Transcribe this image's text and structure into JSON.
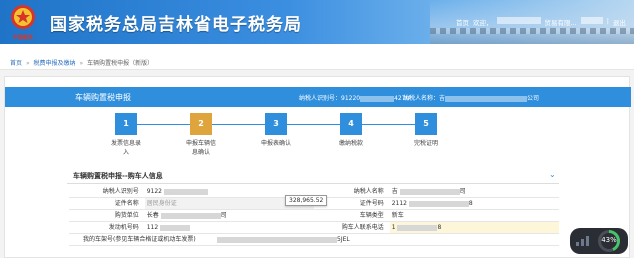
{
  "header": {
    "site_title": "国家税务总局吉林省电子税务局",
    "emblem_text": "中国税务",
    "links": {
      "home": "首页",
      "welcome": "欢迎，",
      "company": "贸易有限...",
      "sep": "|",
      "logout": "退出"
    }
  },
  "breadcrumb": {
    "items": [
      "首页",
      "税费申报及缴纳",
      "车辆购置税申报（新版）"
    ],
    "sep": "»"
  },
  "card": {
    "title": "车辆购置税申报",
    "taxpayer_id_label": "纳税人识别号：",
    "taxpayer_id_value_start": "91220",
    "taxpayer_id_value_end": "427U",
    "taxpayer_name_label": "纳税人名称：",
    "taxpayer_name_value_start": "吉",
    "taxpayer_name_value_end": "公司"
  },
  "steps": [
    {
      "num": "1",
      "label_line1": "发票信息录",
      "label_line2": "入",
      "active": false
    },
    {
      "num": "2",
      "label_line1": "申报车辆信",
      "label_line2": "息确认",
      "active": true
    },
    {
      "num": "3",
      "label_line1": "申报表确认",
      "label_line2": "",
      "active": false
    },
    {
      "num": "4",
      "label_line1": "缴纳税款",
      "label_line2": "",
      "active": false
    },
    {
      "num": "5",
      "label_line1": "完税证明",
      "label_line2": "",
      "active": false
    }
  ],
  "section": {
    "title": "车辆购置税申报--购车人信息",
    "chevron": "⌄"
  },
  "form": {
    "taxpayer_id_label": "纳税人识别号",
    "taxpayer_id_value": "9122",
    "taxpayer_name_label": "纳税人名称",
    "taxpayer_name_value_start": "吉",
    "taxpayer_name_value_end": "司",
    "id_type_label": "证件名称",
    "id_type_value": "居民身份证",
    "id_no_label": "证件号码",
    "id_no_value_start": "2112",
    "id_no_value_end": "8",
    "unit_label": "购货单位",
    "unit_value_start": "长春",
    "unit_value_end": "司",
    "vehicle_type_label": "车辆类型",
    "vehicle_type_value": "新车",
    "engine_label": "发动机号码",
    "engine_value": "112",
    "phone_label": "购车人联系电话",
    "phone_value_start": "1",
    "phone_value_end": "8",
    "vin_label": "我的车架号(参见车辆合格证或机动车发票)",
    "vin_value_end": "5JEL"
  },
  "tooltip": {
    "value": "328,965.52"
  },
  "widget": {
    "percent": "43%",
    "percent_value": 0.43
  }
}
